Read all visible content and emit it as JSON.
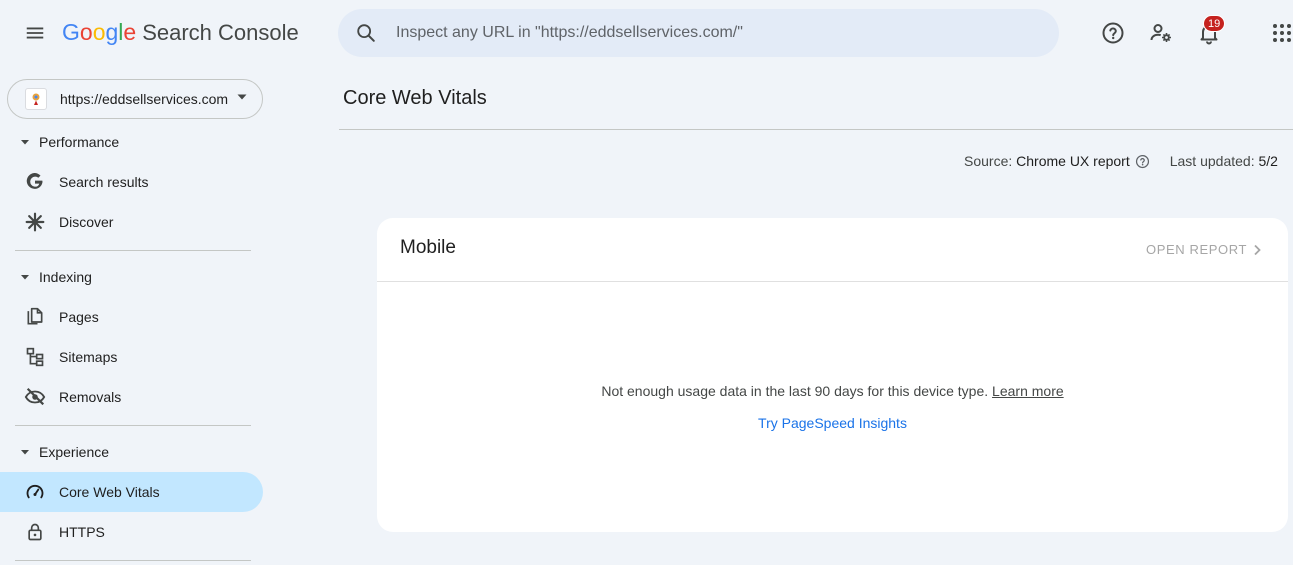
{
  "app": {
    "logo_letters": [
      {
        "ch": "G",
        "color": "#4285F4"
      },
      {
        "ch": "o",
        "color": "#EA4335"
      },
      {
        "ch": "o",
        "color": "#FBBC05"
      },
      {
        "ch": "g",
        "color": "#4285F4"
      },
      {
        "ch": "l",
        "color": "#34A853"
      },
      {
        "ch": "e",
        "color": "#EA4335"
      }
    ],
    "product_name": "Search Console"
  },
  "search": {
    "placeholder": "Inspect any URL in \"https://eddsellservices.com/\"",
    "value": ""
  },
  "header": {
    "notification_count": "19"
  },
  "sidebar": {
    "property_url": "https://eddsellservices.com/",
    "sections": [
      {
        "label": "Performance",
        "items": [
          "Search results",
          "Discover"
        ]
      },
      {
        "label": "Indexing",
        "items": [
          "Pages",
          "Sitemaps",
          "Removals"
        ]
      },
      {
        "label": "Experience",
        "items": [
          "Core Web Vitals",
          "HTTPS"
        ]
      }
    ],
    "active_item": "Core Web Vitals"
  },
  "main": {
    "title": "Core Web Vitals",
    "source_label": "Source:",
    "source_value": "Chrome UX report",
    "last_updated_label": "Last updated:",
    "last_updated_value": "5/2",
    "card": {
      "title": "Mobile",
      "open_report": "OPEN REPORT",
      "empty_message": "Not enough usage data in the last 90 days for this device type.",
      "learn_more": "Learn more",
      "psi_link": "Try PageSpeed Insights"
    }
  },
  "colors": {
    "background": "#f0f4f9",
    "active_nav": "#c2e7ff",
    "search_bg": "#e3ebf7",
    "link_blue": "#1a73e8",
    "badge_red": "#c5221f"
  },
  "icons": {
    "menu": "hamburger-menu-icon",
    "search": "search-icon",
    "help": "help-circle-icon",
    "user_settings": "user-settings-icon",
    "notifications": "bell-icon",
    "apps": "apps-grid-icon"
  }
}
